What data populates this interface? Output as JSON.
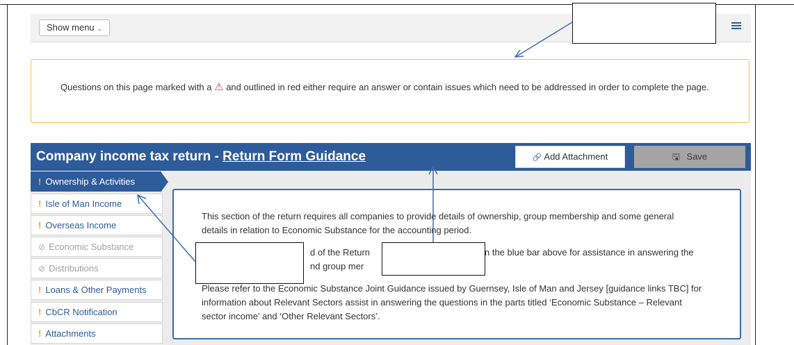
{
  "menubar": {
    "show_menu_label": "Show menu",
    "chevron_glyph": "⌄"
  },
  "warning": {
    "text_before": "Questions on this page marked with a ",
    "icon": "⚠",
    "text_after": " and outlined in red either require an answer or contain issues which need to be addressed in order to complete the page."
  },
  "titlebar": {
    "title_prefix": "Company income tax return - ",
    "title_link": "Return Form Guidance",
    "attach_label": "Add Attachment",
    "attach_icon": "🔗",
    "save_label": "Save",
    "save_icon": "🖫"
  },
  "sidebar": {
    "items": [
      {
        "label": "Ownership & Activities",
        "state": "active",
        "marker": "!"
      },
      {
        "label": "Isle of Man Income",
        "state": "warning",
        "marker": "!"
      },
      {
        "label": "Overseas Income",
        "state": "warning",
        "marker": "!"
      },
      {
        "label": "Economic Substance",
        "state": "disabled",
        "marker": "⊘"
      },
      {
        "label": "Distributions",
        "state": "disabled",
        "marker": "⊘"
      },
      {
        "label": "Loans & Other Payments",
        "state": "warning",
        "marker": "!"
      },
      {
        "label": "CbCR Notification",
        "state": "warning",
        "marker": "!"
      },
      {
        "label": "Attachments",
        "state": "warning",
        "marker": "!"
      }
    ]
  },
  "main": {
    "para1_line1": "This section of the return requires all companies to provide details of ownership, group membership and some general",
    "para1_line2": "details in relation to Economic Substance for the accounting period.",
    "para2_line1_a": "d of the Return",
    "para2_line1_b": "n the blue bar above for assistance in answering the",
    "para2_line2_a": "nd group mer",
    "para3_line1": "Please refer to the Economic Substance Joint Guidance issued by Guernsey, Isle of Man and Jersey [guidance links TBC] for",
    "para3_line2": "information about Relevant Sectors assist in answering the questions in the parts titled ‘Economic Substance – Relevant",
    "para3_line3": "sector income’ and ‘Other Relevant Sectors’."
  },
  "colors": {
    "brand_blue": "#2e5b9a",
    "warning_border": "#f0c24a",
    "warning_icon": "#e03b2a",
    "marker_orange": "#f0a020",
    "annotation_arrow": "#3a6db0"
  }
}
